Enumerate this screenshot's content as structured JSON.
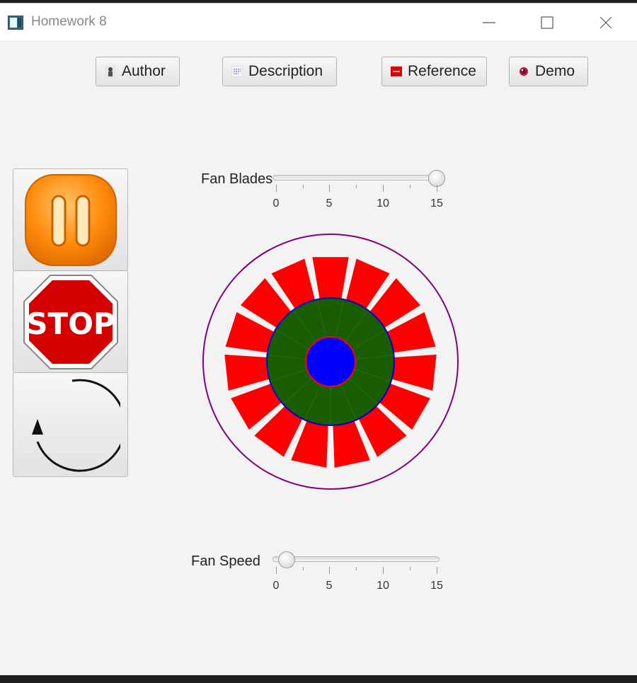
{
  "window": {
    "title": "Homework 8",
    "controls": [
      "minimize-icon",
      "maximize-icon",
      "close-icon"
    ]
  },
  "toolbar": {
    "author_label": "Author",
    "description_label": "Description",
    "reference_label": "Reference",
    "demo_label": "Demo"
  },
  "side_buttons": [
    {
      "name": "pause",
      "icon": "pause-icon"
    },
    {
      "name": "stop",
      "icon": "stop-sign-icon",
      "text": "STOP"
    },
    {
      "name": "reset",
      "icon": "circular-arrow-icon"
    }
  ],
  "fan_blades_slider": {
    "label": "Fan Blades",
    "min": 0,
    "max": 15,
    "value": 15,
    "tick_labels": [
      "0",
      "5",
      "10",
      "15"
    ]
  },
  "fan_speed_slider": {
    "label": "Fan Speed",
    "min": 0,
    "max": 15,
    "value": 1,
    "tick_labels": [
      "0",
      "5",
      "10",
      "15"
    ]
  },
  "fan": {
    "blade_count": 15,
    "colors": {
      "outer_ring": "#800080",
      "blades": "#ff0000",
      "hub": "#1a5c00",
      "hub_border": "#0000cc",
      "center": "#0000ff",
      "center_border": "#ff0000"
    }
  }
}
